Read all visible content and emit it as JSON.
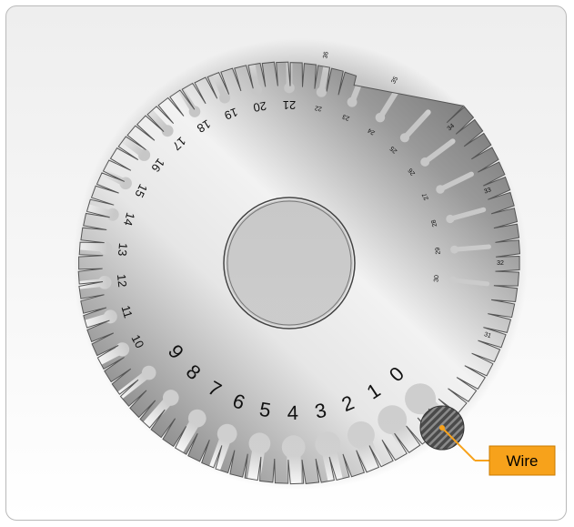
{
  "gauge": {
    "slot_labels": [
      "0",
      "1",
      "2",
      "3",
      "4",
      "5",
      "6",
      "7",
      "8",
      "9",
      "10",
      "11",
      "12",
      "13",
      "14",
      "15",
      "16",
      "17",
      "18",
      "19",
      "20",
      "21",
      "22",
      "23",
      "24",
      "25",
      "26",
      "27",
      "28",
      "29",
      "30"
    ],
    "back_labels": [
      "31",
      "32",
      "33",
      "34",
      "35",
      "36"
    ]
  },
  "callout": {
    "label": "Wire"
  },
  "colors": {
    "callout_fill": "#f7a21b",
    "callout_line": "#f7a21b",
    "wire_fill": "#555555"
  }
}
